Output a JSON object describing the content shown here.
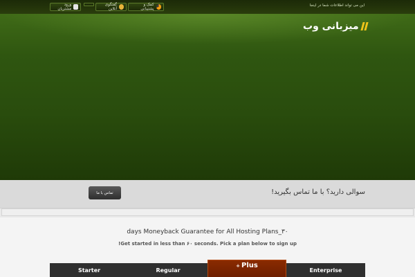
{
  "topbar": {
    "notice": "این می تواند اطلاعات شما در اینجا",
    "support_label": "کمک و پشتیبانی",
    "chat_label": "گفتگوی آنلاین",
    "login_label": "ورود مشتریان"
  },
  "logo": {
    "text": "میزبانی وب"
  },
  "contact": {
    "question": "سوالی دارید؟ با ما تماس بگیرید!",
    "button_label": "تماس با ما"
  },
  "pricing": {
    "headline": "days Moneyback Guarantee for All Hosting Plans_۳۰",
    "subline": "!Get started in less than ۶۰ seconds. Pick a plan below to sign up",
    "tabs": [
      {
        "label": "Starter"
      },
      {
        "label": "Regular"
      },
      {
        "label": "Plus",
        "badge": "+",
        "active": true
      },
      {
        "label": "Enterprise"
      }
    ]
  },
  "colors": {
    "accent_active_tab": "#7a2400",
    "hero_green": "#2f5610",
    "logo_mark": "#f0c419"
  }
}
